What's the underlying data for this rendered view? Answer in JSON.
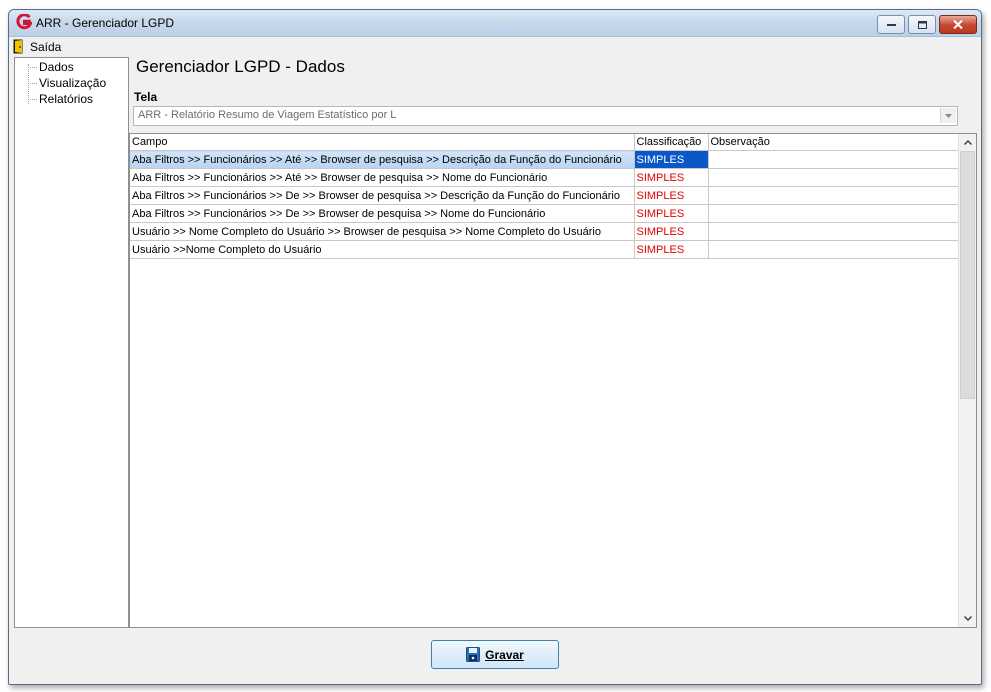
{
  "window": {
    "title": "ARR - Gerenciador LGPD",
    "app_icon": "app-logo-icon"
  },
  "menu": {
    "exit_label": "Saída",
    "exit_icon": "exit-door-icon"
  },
  "tree": {
    "items": [
      "Dados",
      "Visualização",
      "Relatórios"
    ]
  },
  "panel": {
    "title": "Gerenciador LGPD - Dados",
    "tela_label": "Tela",
    "tela_value": "ARR - Relatório Resumo de Viagem Estatístico por L"
  },
  "grid": {
    "columns": [
      "Campo",
      "Classificação",
      "Observação"
    ],
    "rows": [
      {
        "campo": "Aba Filtros >> Funcionários >> Até >> Browser de pesquisa >> Descrição da Função do Funcionário",
        "classificacao": "SIMPLES",
        "observacao": ""
      },
      {
        "campo": "Aba Filtros >> Funcionários >> Até >> Browser de pesquisa >> Nome do Funcionário",
        "classificacao": "SIMPLES",
        "observacao": ""
      },
      {
        "campo": "Aba Filtros >> Funcionários >> De >> Browser de pesquisa >> Descrição da Função do Funcionário",
        "classificacao": "SIMPLES",
        "observacao": ""
      },
      {
        "campo": "Aba Filtros >> Funcionários >> De >> Browser de pesquisa >> Nome do Funcionário",
        "classificacao": "SIMPLES",
        "observacao": ""
      },
      {
        "campo": "Usuário >> Nome Completo do Usuário >> Browser de pesquisa >> Nome Completo do Usuário",
        "classificacao": "SIMPLES",
        "observacao": ""
      },
      {
        "campo": "Usuário >>Nome Completo do Usuário",
        "classificacao": "SIMPLES",
        "observacao": ""
      }
    ],
    "selected_row": 0
  },
  "actions": {
    "save_label": "Gravar",
    "save_icon": "floppy-disk-icon"
  },
  "colors": {
    "classification_text": "#e00000",
    "selection": "#0a58c8"
  }
}
